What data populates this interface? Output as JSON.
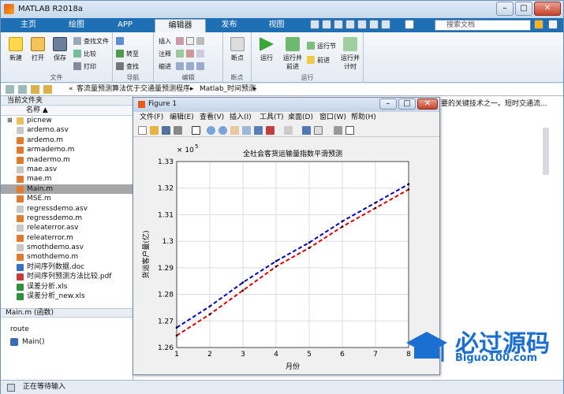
{
  "app": {
    "title": "MATLAB R2018a"
  },
  "window_controls": {
    "minimize": "–",
    "maximize": "□",
    "close": "✕"
  },
  "ribbon_tabs": [
    "主页",
    "绘图",
    "APP",
    "编辑器",
    "发布",
    "视图"
  ],
  "search": {
    "placeholder": "搜索文档"
  },
  "ribbon": {
    "groups": {
      "file": "文件",
      "nav": "导航",
      "edit": "编辑",
      "breakpoints": "断点",
      "run": "运行"
    },
    "new": "新建",
    "open": "打开",
    "save": "保存",
    "find_files": "查找文件",
    "compare": "比较",
    "print": "打印",
    "goto": "转至",
    "find": "查找",
    "insert": "插入",
    "comment": "注释",
    "indent": "缩进",
    "breakpoints": "断点",
    "run": "运行",
    "run_advance": "运行并\n前进",
    "run_section": "运行节",
    "advance": "前进",
    "run_time": "运行并\n计时"
  },
  "address": {
    "path_prefix": "«",
    "path_1": "客流量预测算法优于交通量预测程序",
    "sep": "▸",
    "path_2": "Matlab_时间预测",
    "arrow": "▸"
  },
  "current_folder": {
    "header": "当前文件夹",
    "column": "名称",
    "sort": "▲",
    "files": [
      {
        "name": "picnew",
        "type": "folder"
      },
      {
        "name": "ardemo.asv",
        "type": "asv"
      },
      {
        "name": "ardemo.m",
        "type": "m"
      },
      {
        "name": "armademo.m",
        "type": "m"
      },
      {
        "name": "madermo.m",
        "type": "m"
      },
      {
        "name": "mae.asv",
        "type": "asv"
      },
      {
        "name": "mae.m",
        "type": "m"
      },
      {
        "name": "Main.m",
        "type": "m",
        "selected": true
      },
      {
        "name": "MSE.m",
        "type": "m"
      },
      {
        "name": "regressdemo.asv",
        "type": "asv"
      },
      {
        "name": "regressdemo.m",
        "type": "m"
      },
      {
        "name": "releaterror.asv",
        "type": "asv"
      },
      {
        "name": "releaterror.m",
        "type": "m"
      },
      {
        "name": "smothdemo.asv",
        "type": "asv"
      },
      {
        "name": "smothdemo.m",
        "type": "m"
      },
      {
        "name": "时间序列数据.doc",
        "type": "doc"
      },
      {
        "name": "时间序列预测方法比较.pdf",
        "type": "pdf"
      },
      {
        "name": "误差分析.xls",
        "type": "xls"
      },
      {
        "name": "误差分析_new.xls",
        "type": "xls"
      }
    ]
  },
  "details": {
    "header": "Main.m  (函数)",
    "line1": "route",
    "func": "Main()"
  },
  "editor_text": "要的关键技术之一。短时交通流...",
  "status": {
    "text": "正在等待输入"
  },
  "figure": {
    "title": "Figure 1",
    "menu": [
      "文件(F)",
      "编辑(E)",
      "查看(V)",
      "插入(I)",
      "工具(T)",
      "桌面(D)",
      "窗口(W)",
      "帮助(H)"
    ]
  },
  "watermark": {
    "text": "必过源码",
    "sub": "Biguo100.com"
  },
  "chart_data": {
    "type": "line",
    "title": "全社会客货运输量指数平滑预测",
    "xlabel": "月份",
    "ylabel": "货运客户量(亿)",
    "exponent_label": "× 10",
    "exponent": "5",
    "xlim": [
      1,
      8
    ],
    "ylim": [
      1.26,
      1.33
    ],
    "xticks": [
      1,
      2,
      3,
      4,
      5,
      6,
      7,
      8
    ],
    "yticks": [
      1.26,
      1.27,
      1.28,
      1.29,
      1.3,
      1.31,
      1.32,
      1.33
    ],
    "ytick_labels": [
      "1.26",
      "1.27",
      "1.28",
      "1.29",
      "1.3",
      "1.31",
      "1.32",
      "1.33"
    ],
    "grid": true,
    "series": [
      {
        "color": "#0000cc",
        "style": "dashed",
        "x": [
          1,
          2,
          3,
          4,
          5,
          6,
          7,
          8
        ],
        "y": [
          1.2675,
          1.2755,
          1.2845,
          1.2925,
          1.2995,
          1.3075,
          1.3145,
          1.3215
        ]
      },
      {
        "color": "#dd0000",
        "style": "dashed",
        "x": [
          1,
          2,
          3,
          4,
          5,
          6,
          7,
          8
        ],
        "y": [
          1.2645,
          1.2725,
          1.2815,
          1.2905,
          1.2975,
          1.3055,
          1.3125,
          1.3195
        ]
      }
    ]
  }
}
